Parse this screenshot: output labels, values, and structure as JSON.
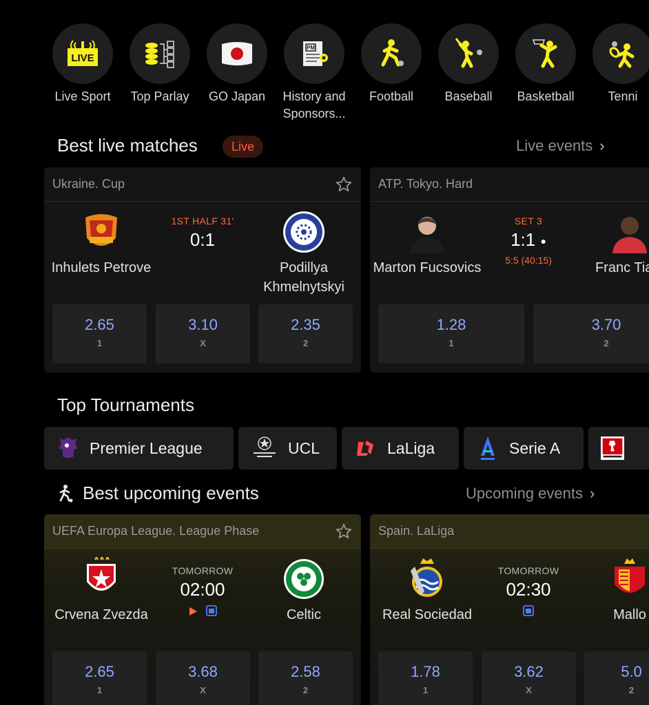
{
  "sports": [
    {
      "label": "Live Sport",
      "icon": "live-icon"
    },
    {
      "label": "Top Parlay",
      "icon": "parlay-icon"
    },
    {
      "label": "GO Japan",
      "icon": "japan-flag-icon"
    },
    {
      "label": "History and Sponsors...",
      "icon": "pm-document-icon"
    },
    {
      "label": "Football",
      "icon": "football-icon"
    },
    {
      "label": "Baseball",
      "icon": "baseball-icon"
    },
    {
      "label": "Basketball",
      "icon": "basketball-icon"
    },
    {
      "label": "Tenni",
      "icon": "tennis-icon"
    }
  ],
  "live_section": {
    "title": "Best live matches",
    "badge": "Live",
    "link": "Live events",
    "cards": [
      {
        "league": "Ukraine. Cup",
        "home": "Inhulets Petrove",
        "away": "Podillya Khmelnytskyi",
        "status": "1ST HALF 31'",
        "score": "0:1",
        "odds": [
          {
            "value": "2.65",
            "key": "1"
          },
          {
            "value": "3.10",
            "key": "X"
          },
          {
            "value": "2.35",
            "key": "2"
          }
        ]
      },
      {
        "league": "ATP. Tokyo. Hard",
        "home": "Marton Fucsovics",
        "away": "Franc Tiafo",
        "status": "SET 3",
        "score": "1:1",
        "sub": "5:5 (40:15)",
        "odds": [
          {
            "value": "1.28",
            "key": "1"
          },
          {
            "value": "3.70",
            "key": "2"
          }
        ]
      }
    ]
  },
  "tournaments": {
    "title": "Top Tournaments",
    "items": [
      {
        "label": "Premier League"
      },
      {
        "label": "UCL"
      },
      {
        "label": "LaLiga"
      },
      {
        "label": "Serie A"
      },
      {
        "label": ""
      }
    ]
  },
  "upcoming_section": {
    "title": "Best upcoming events",
    "link": "Upcoming events",
    "cards": [
      {
        "league": "UEFA Europa League. League Phase",
        "home": "Crvena Zvezda",
        "away": "Celtic",
        "day": "TOMORROW",
        "time": "02:00",
        "odds": [
          {
            "value": "2.65",
            "key": "1"
          },
          {
            "value": "3.68",
            "key": "X"
          },
          {
            "value": "2.58",
            "key": "2"
          }
        ]
      },
      {
        "league": "Spain. LaLiga",
        "home": "Real Sociedad",
        "away": "Mallo",
        "day": "TOMORROW",
        "time": "02:30",
        "odds": [
          {
            "value": "1.78",
            "key": "1"
          },
          {
            "value": "3.62",
            "key": "X"
          },
          {
            "value": "5.0",
            "key": "2"
          }
        ]
      }
    ]
  },
  "colors": {
    "accent_yellow": "#f6ee1f",
    "odds_blue": "#8ea8ff",
    "live_orange": "#ff6a3d",
    "card_bg": "#151515"
  }
}
